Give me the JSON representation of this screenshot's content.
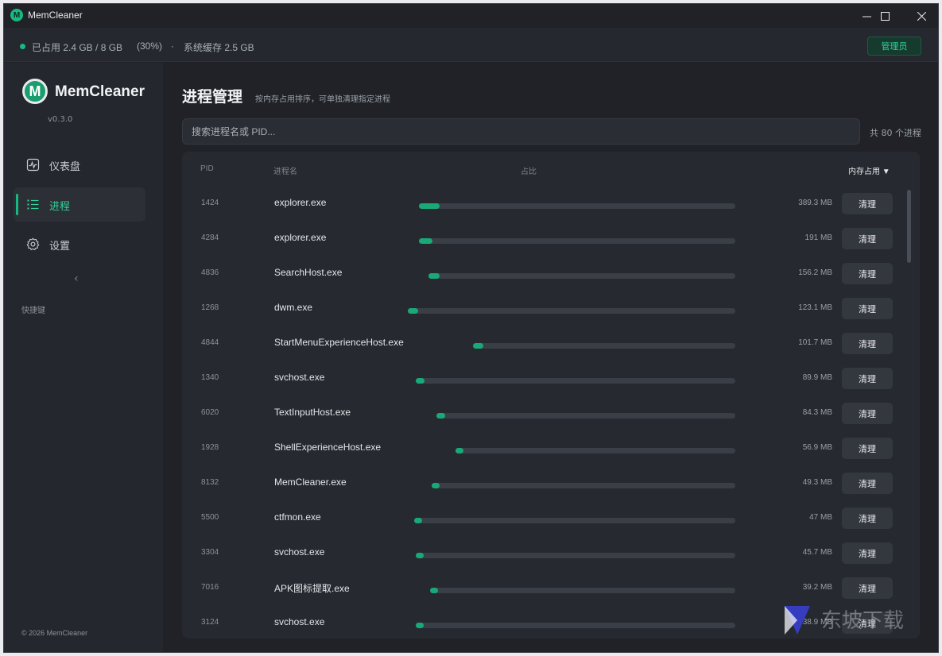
{
  "window": {
    "title": "MemCleaner",
    "logo_letter": "M",
    "controls": {
      "minimize": "—",
      "maximize": "☐",
      "close": "✕"
    }
  },
  "status": {
    "used": "已占用 2.4 GB / 8 GB",
    "percent": "(30%)",
    "separator": "·",
    "cache": "系统缓存 2.5 GB",
    "role_badge": "管理员"
  },
  "sidebar": {
    "brand": "MemCleaner",
    "logo_letter": "M",
    "version": "v0.3.0",
    "items": [
      {
        "label": "仪表盘",
        "icon": "chart-pulse-icon",
        "active": false
      },
      {
        "label": "进程",
        "icon": "list-icon",
        "active": true
      },
      {
        "label": "设置",
        "icon": "gear-icon",
        "active": false
      }
    ],
    "collapse": "‹",
    "shortcut_label": "快捷键",
    "copyright": "© 2026 MemCleaner"
  },
  "main": {
    "title": "进程管理",
    "subtitle": "按内存占用排序，可单独清理指定进程",
    "search_placeholder": "搜索进程名或 PID...",
    "total": "共 80 个进程"
  },
  "table": {
    "headers": {
      "pid": "PID",
      "name": "进程名",
      "ratio": "占比",
      "memory": "内存占用 ▼"
    },
    "action_label": "清理",
    "rows": [
      {
        "pid": "1424",
        "name": "explorer.exe",
        "mem": "389.3 MB",
        "fraction": 0.066
      },
      {
        "pid": "4284",
        "name": "explorer.exe",
        "mem": "191 MB",
        "fraction": 0.043
      },
      {
        "pid": "4836",
        "name": "SearchHost.exe",
        "mem": "156.2 MB",
        "fraction": 0.036
      },
      {
        "pid": "1268",
        "name": "dwm.exe",
        "mem": "123.1 MB",
        "fraction": 0.033
      },
      {
        "pid": "4844",
        "name": "StartMenuExperienceHost.exe",
        "mem": "101.7 MB",
        "fraction": 0.033
      },
      {
        "pid": "1340",
        "name": "svchost.exe",
        "mem": "89.9 MB",
        "fraction": 0.029
      },
      {
        "pid": "6020",
        "name": "TextInputHost.exe",
        "mem": "84.3 MB",
        "fraction": 0.028
      },
      {
        "pid": "1928",
        "name": "ShellExperienceHost.exe",
        "mem": "56.9 MB",
        "fraction": 0.026
      },
      {
        "pid": "8132",
        "name": "MemCleaner.exe",
        "mem": "49.3 MB",
        "fraction": 0.025
      },
      {
        "pid": "5500",
        "name": "ctfmon.exe",
        "mem": "47 MB",
        "fraction": 0.025
      },
      {
        "pid": "3304",
        "name": "svchost.exe",
        "mem": "45.7 MB",
        "fraction": 0.024
      },
      {
        "pid": "7016",
        "name": "APK图标提取.exe",
        "mem": "39.2 MB",
        "fraction": 0.024
      },
      {
        "pid": "3124",
        "name": "svchost.exe",
        "mem": "38.9 MB",
        "fraction": 0.024
      }
    ]
  },
  "colors": {
    "accent": "#19b882",
    "bar_fill": "#19a878",
    "bar_track": "#3a3e46",
    "background": "#202227",
    "panel": "#26292f"
  },
  "watermark": {
    "text": "东坡下载"
  }
}
